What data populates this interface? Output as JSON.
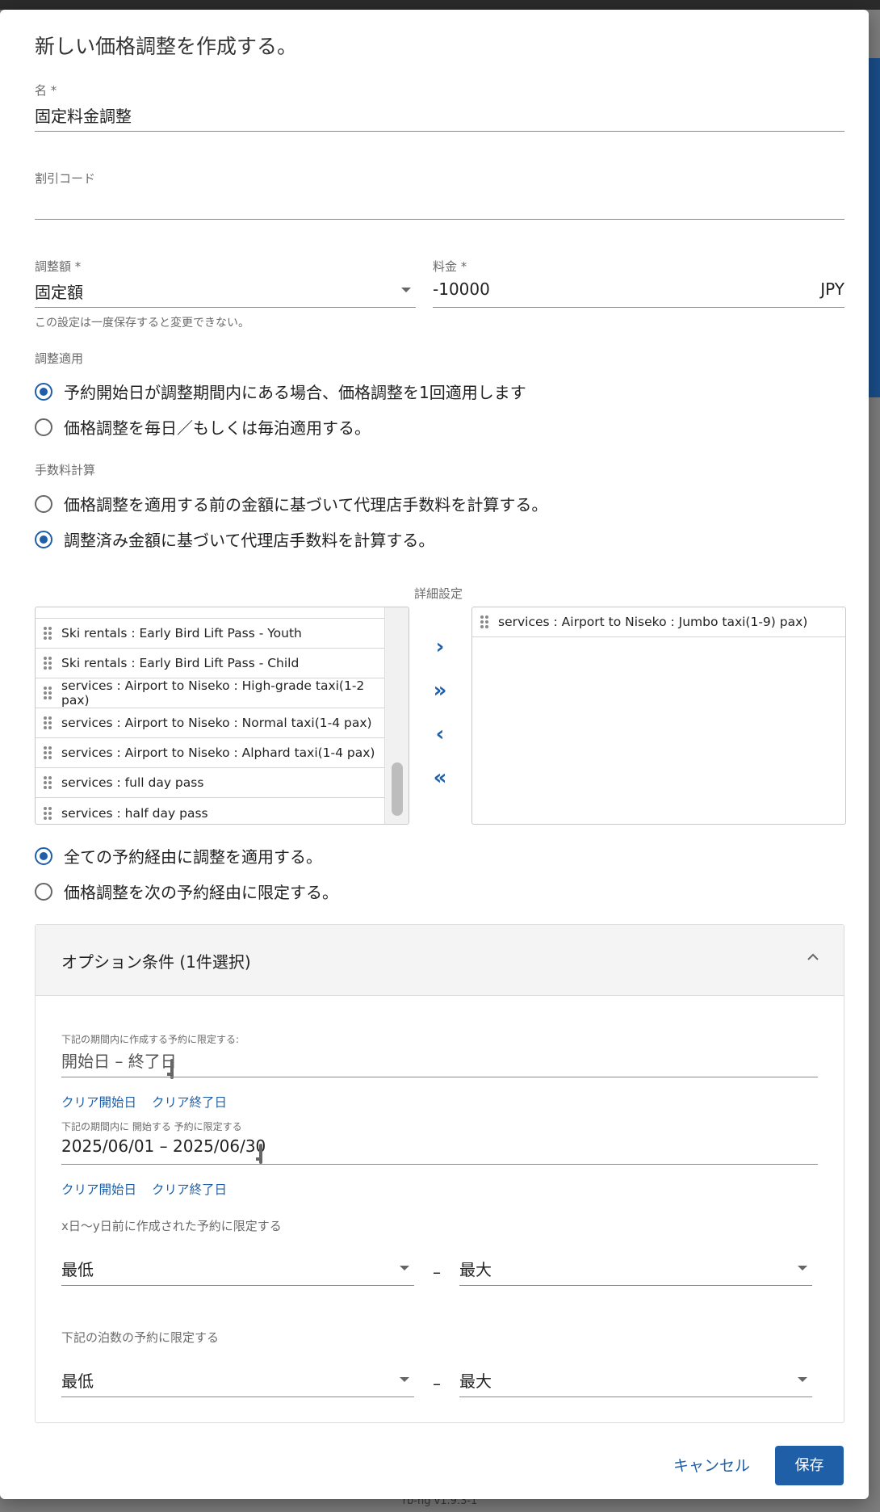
{
  "dialog": {
    "title": "新しい価格調整を作成する。"
  },
  "fields": {
    "name": {
      "label": "名 *",
      "value": "固定料金調整"
    },
    "discount_code": {
      "label": "割引コード",
      "value": ""
    },
    "adjustment_type": {
      "label": "調整額 *",
      "value": "固定額",
      "hint": "この設定は一度保存すると変更できない。"
    },
    "amount": {
      "label": "料金 *",
      "value": "-10000",
      "currency": "JPY"
    }
  },
  "apply_section": {
    "label": "調整適用",
    "options": [
      {
        "label": "予約開始日が調整期間内にある場合、価格調整を1回適用します",
        "selected": true
      },
      {
        "label": "価格調整を毎日／もしくは毎泊適用する。",
        "selected": false
      }
    ]
  },
  "commission_section": {
    "label": "手数料計算",
    "options": [
      {
        "label": "価格調整を適用する前の金額に基づいて代理店手数料を計算する。",
        "selected": false
      },
      {
        "label": "調整済み金額に基づいて代理店手数料を計算する。",
        "selected": true
      }
    ]
  },
  "details": {
    "label": "詳細設定",
    "available_items": [
      "Ski rentals : Early Bird Lift Pass - Youth",
      "Ski rentals : Early Bird Lift Pass - Child",
      "services : Airport to Niseko : High-grade taxi(1-2 pax)",
      "services : Airport to Niseko : Normal taxi(1-4 pax)",
      "services : Airport to Niseko : Alphard taxi(1-4 pax)",
      "services : full day pass",
      "services : half day pass"
    ],
    "selected_items": [
      "services : Airport to Niseko : Jumbo taxi(1-9) pax)"
    ],
    "buttons": {
      "add": "›",
      "add_all": "»",
      "remove": "‹",
      "remove_all": "«"
    }
  },
  "channel_section": {
    "options": [
      {
        "label": "全ての予約経由に調整を適用する。",
        "selected": true
      },
      {
        "label": "価格調整を次の予約経由に限定する。",
        "selected": false
      }
    ]
  },
  "optional_conditions": {
    "title": "オプション条件 (1件選択)",
    "created_range": {
      "label": "下記の期間内に作成する予約に限定する:",
      "value": "開始日 – 終了日",
      "clear_start": "クリア開始日",
      "clear_end": "クリア終了日"
    },
    "start_range": {
      "label": "下記の期間内に 開始する 予約に限定する",
      "value": "2025/06/01 – 2025/06/30",
      "clear_start": "クリア開始日",
      "clear_end": "クリア終了日"
    },
    "days_before": {
      "label": "x日〜y日前に作成された予約に限定する",
      "min": "最低",
      "max": "最大",
      "separator": "–"
    },
    "nights": {
      "label": "下記の泊数の予約に限定する",
      "min": "最低",
      "max": "最大",
      "separator": "–"
    }
  },
  "actions": {
    "cancel": "キャンセル",
    "save": "保存"
  },
  "background": {
    "version_text": "rb-ng v1.9.3-1"
  },
  "colors": {
    "accent": "#1f5fa8",
    "overlay": "#7d7d7d"
  }
}
